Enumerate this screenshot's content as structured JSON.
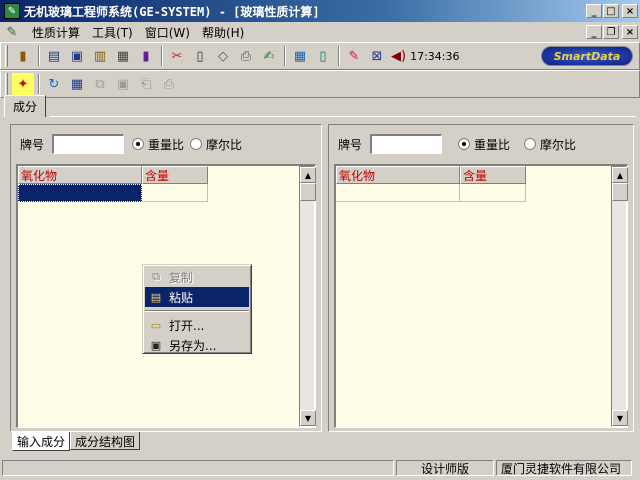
{
  "window": {
    "title": "无机玻璃工程师系统(GE-SYSTEM) - [玻璃性质计算]",
    "min_label": "_",
    "max_label": "□",
    "close_label": "×",
    "restore_label": "❐"
  },
  "menubar": {
    "items": [
      "性质计算",
      "工具(T)",
      "窗口(W)",
      "帮助(H)"
    ]
  },
  "toolbar": {
    "clock": "17:34:36",
    "brand": "SmartData"
  },
  "top_tab": {
    "label": "成分"
  },
  "left_pane": {
    "grade_label": "牌号",
    "grade_value": "",
    "radio_weight": "重量比",
    "radio_molar": "摩尔比",
    "col_oxide": "氧化物",
    "col_content": "含量"
  },
  "right_pane": {
    "grade_label": "牌号",
    "grade_value": "",
    "radio_weight": "重量比",
    "radio_molar": "摩尔比",
    "col_oxide": "氧化物",
    "col_content": "含量"
  },
  "context_menu": {
    "copy": "复制",
    "paste": "粘贴",
    "open": "打开...",
    "save_as": "另存为..."
  },
  "bottom_tabs": [
    "输入成分",
    "成分结构图"
  ],
  "statusbar": {
    "edition": "设计师版",
    "company": "厦门灵捷软件有限公司"
  },
  "colors": {
    "title_start": "#0a246a",
    "grid_bg": "#fffde7",
    "header_text": "#c00000",
    "selection": "#0a246a"
  }
}
